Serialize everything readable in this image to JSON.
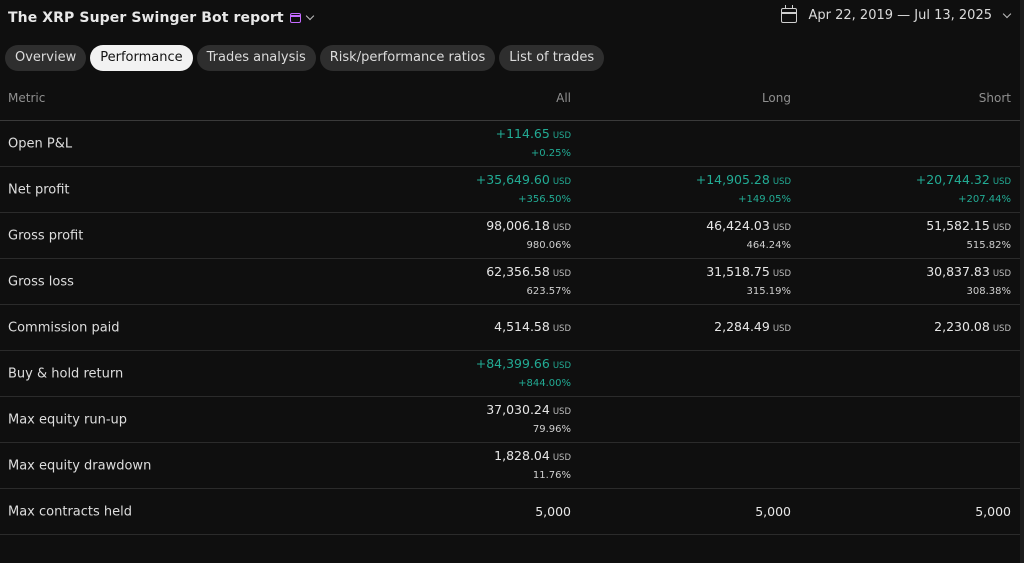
{
  "header": {
    "title": "The XRP Super Swinger Bot report",
    "date_range": "Apr 22, 2019 — Jul 13, 2025"
  },
  "tabs": [
    {
      "label": "Overview",
      "active": false
    },
    {
      "label": "Performance",
      "active": true
    },
    {
      "label": "Trades analysis",
      "active": false
    },
    {
      "label": "Risk/performance ratios",
      "active": false
    },
    {
      "label": "List of trades",
      "active": false
    }
  ],
  "table": {
    "columns": {
      "metric": "Metric",
      "all": "All",
      "long": "Long",
      "short": "Short"
    },
    "currency": "USD",
    "rows": [
      {
        "metric": "Open P&L",
        "all": {
          "value": "+114.65",
          "pct": "+0.25%"
        },
        "long": null,
        "short": null
      },
      {
        "metric": "Net profit",
        "all": {
          "value": "+35,649.60",
          "pct": "+356.50%"
        },
        "long": {
          "value": "+14,905.28",
          "pct": "+149.05%"
        },
        "short": {
          "value": "+20,744.32",
          "pct": "+207.44%"
        }
      },
      {
        "metric": "Gross profit",
        "all": {
          "value": "98,006.18",
          "pct": "980.06%"
        },
        "long": {
          "value": "46,424.03",
          "pct": "464.24%"
        },
        "short": {
          "value": "51,582.15",
          "pct": "515.82%"
        }
      },
      {
        "metric": "Gross loss",
        "all": {
          "value": "62,356.58",
          "pct": "623.57%"
        },
        "long": {
          "value": "31,518.75",
          "pct": "315.19%"
        },
        "short": {
          "value": "30,837.83",
          "pct": "308.38%"
        }
      },
      {
        "metric": "Commission paid",
        "all": {
          "value": "4,514.58"
        },
        "long": {
          "value": "2,284.49"
        },
        "short": {
          "value": "2,230.08"
        }
      },
      {
        "metric": "Buy & hold return",
        "all": {
          "value": "+84,399.66",
          "pct": "+844.00%"
        },
        "long": null,
        "short": null
      },
      {
        "metric": "Max equity run-up",
        "all": {
          "value": "37,030.24",
          "pct": "79.96%"
        },
        "long": null,
        "short": null
      },
      {
        "metric": "Max equity drawdown",
        "all": {
          "value": "1,828.04",
          "pct": "11.76%"
        },
        "long": null,
        "short": null
      },
      {
        "metric": "Max contracts held",
        "all": {
          "value": "5,000",
          "unitless": true
        },
        "long": {
          "value": "5,000",
          "unitless": true
        },
        "short": {
          "value": "5,000",
          "unitless": true
        }
      }
    ]
  },
  "colors": {
    "background": "#0f0f0f",
    "positive": "#22ab94",
    "accent_icon": "#c46bff"
  },
  "icons": {
    "title_icon": "calendar-badge-icon",
    "title_dropdown": "chevron-down-icon",
    "date_icon": "calendar-icon",
    "date_dropdown": "chevron-down-icon"
  }
}
